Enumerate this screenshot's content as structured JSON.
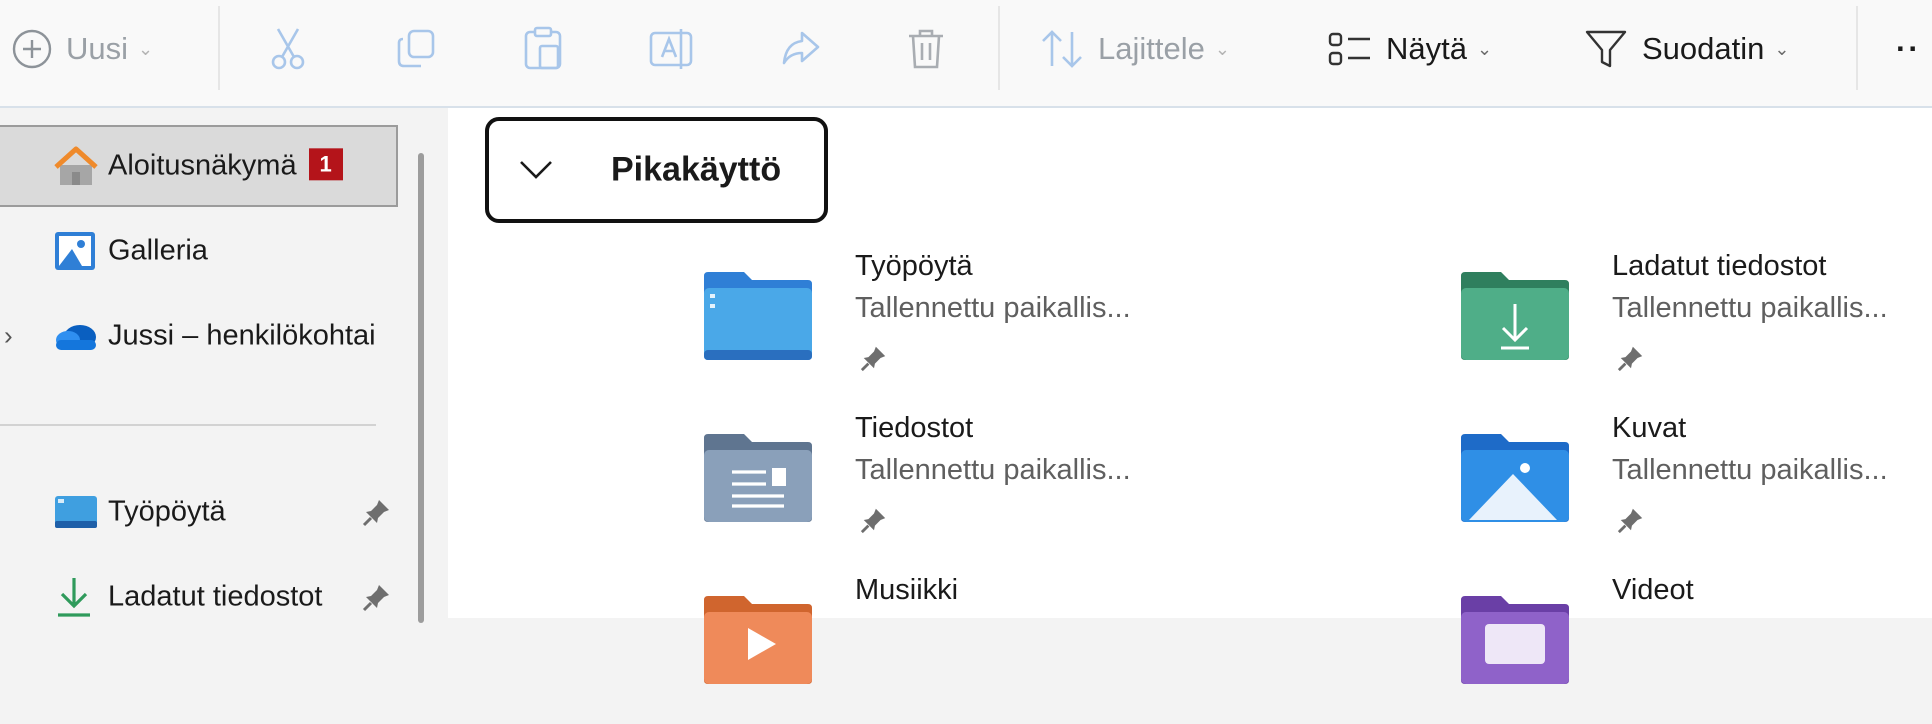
{
  "toolbar": {
    "new_label": "Uusi",
    "sort_label": "Lajittele",
    "view_label": "Näytä",
    "filter_label": "Suodatin",
    "more_label": "··"
  },
  "sidebar": {
    "items": [
      {
        "label": "Aloitusnäkymä",
        "badge": "1",
        "icon": "home-icon",
        "selected": true
      },
      {
        "label": "Galleria",
        "icon": "gallery-icon"
      },
      {
        "label": "Jussi – henkilökohtai",
        "icon": "onedrive-cloud-icon",
        "expandable": true
      },
      {
        "label": "Työpöytä",
        "icon": "desktop-folder-icon",
        "pinned": true
      },
      {
        "label": "Ladatut tiedostot",
        "icon": "download-arrow-icon",
        "pinned": true
      }
    ]
  },
  "main": {
    "section_title": "Pikakäyttö",
    "items": [
      {
        "name": "Työpöytä",
        "sub": "Tallennettu paikallis...",
        "icon": "desktop-folder-icon",
        "pinned": true
      },
      {
        "name": "Ladatut tiedostot",
        "sub": "Tallennettu paikallis...",
        "icon": "downloads-folder-icon",
        "pinned": true
      },
      {
        "name": "Tiedostot",
        "sub": "Tallennettu paikallis...",
        "icon": "documents-folder-icon",
        "pinned": true
      },
      {
        "name": "Kuvat",
        "sub": "Tallennettu paikallis...",
        "icon": "pictures-folder-icon",
        "pinned": true
      },
      {
        "name": "Musiikki",
        "icon": "music-folder-icon"
      },
      {
        "name": "Videot",
        "icon": "videos-folder-icon"
      }
    ]
  },
  "colors": {
    "badge": "#b4141a",
    "accent_blue": "#2f7fd6",
    "downloads_green": "#3fa57f",
    "music_orange": "#e06a3a",
    "videos_purple": "#7a4fb0"
  }
}
